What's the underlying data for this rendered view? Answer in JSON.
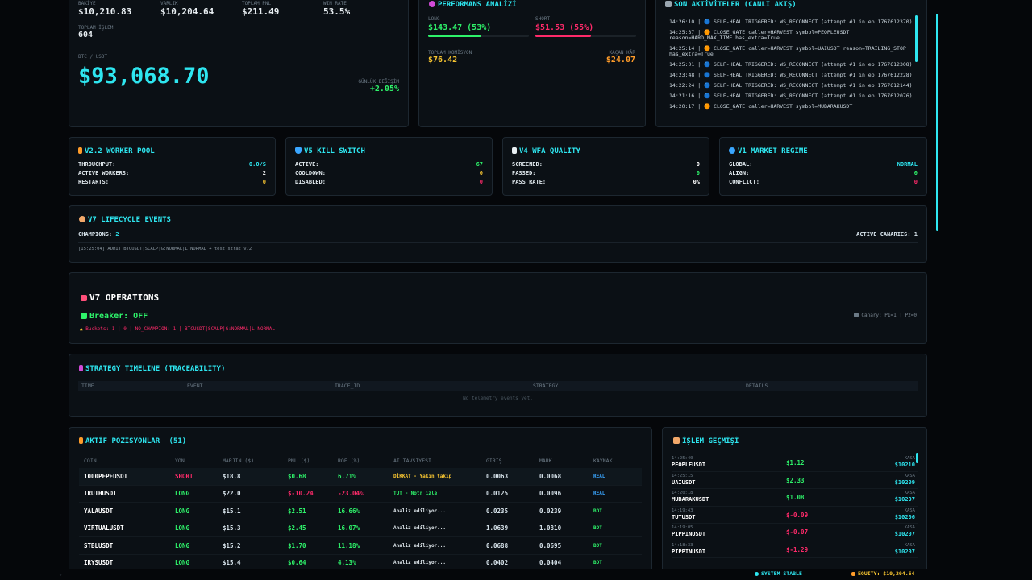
{
  "stats": {
    "balance_label": "BAKİYE",
    "balance": "$10,210.83",
    "equity_label": "VARLIK",
    "equity": "$10,204.64",
    "pnl_label": "TOPLAM PNL",
    "pnl": "$211.49",
    "winrate_label": "WIN RATE",
    "winrate": "53.5%",
    "trades_label": "TOPLAM İŞLEM",
    "trades": "604",
    "pair_label": "BTC / USDT",
    "price": "$93,068.70",
    "change_label": "GÜNLÜK DEĞİŞİM",
    "change": "+2.05%"
  },
  "performance": {
    "title": "PERFORMANS ANALİZİ",
    "long_label": "LONG",
    "long_value": "$143.47 (53%)",
    "long_fill": 0.53,
    "short_label": "SHORT",
    "short_value": "$51.53 (55%)",
    "short_fill": 0.55,
    "commission_label": "TOPLAM KOMİSYON",
    "commission_value": "$76.42",
    "missed_label": "KAÇAN KÂR",
    "missed_value": "$24.07"
  },
  "activity": {
    "title": "SON AKTİVİTELER (CANLI AKIŞ)",
    "lines": [
      "14:26:10 | 🔵 SELF-HEAL TRIGGERED: WS_RECONNECT (attempt #1 in ep:1767612370)",
      "14:25:37 | 🟠 CLOSE_GATE caller=HARVEST symbol=PEOPLEUSDT reason=HARD_MAX_TIME has_extra=True",
      "14:25:14 | 🟠 CLOSE_GATE caller=HARVEST symbol=UAIUSDT reason=TRAILING_STOP has_extra=True",
      "14:25:01 | 🔵 SELF-HEAL TRIGGERED: WS_RECONNECT (attempt #1 in ep:1767612308)",
      "14:23:48 | 🔵 SELF-HEAL TRIGGERED: WS_RECONNECT (attempt #1 in ep:1767612228)",
      "14:22:24 | 🔵 SELF-HEAL TRIGGERED: WS_RECONNECT (attempt #1 in ep:1767612144)",
      "14:21:16 | 🔵 SELF-HEAL TRIGGERED: WS_RECONNECT (attempt #1 in ep:1767612076)",
      "14:20:17 | 🟠 CLOSE_GATE caller=HARVEST symbol=MUBARAKUSDT"
    ]
  },
  "modules": [
    {
      "title": "V2.2 WORKER POOL",
      "icon": "lightning-icon",
      "rows": [
        {
          "label": "THROUGHPUT:",
          "value": "0.0/s",
          "color": "#2ee6f0"
        },
        {
          "label": "ACTIVE WORKERS:",
          "value": "2",
          "color": "#ffffff"
        },
        {
          "label": "RESTARTS:",
          "value": "0",
          "color": "#f7c531"
        }
      ]
    },
    {
      "title": "V5 KILL SWITCH",
      "icon": "shield-icon",
      "rows": [
        {
          "label": "ACTIVE:",
          "value": "67",
          "color": "#2ef26a"
        },
        {
          "label": "COOLDOWN:",
          "value": "0",
          "color": "#f7c531"
        },
        {
          "label": "DISABLED:",
          "value": "0",
          "color": "#ff2a6a"
        }
      ]
    },
    {
      "title": "V4 WFA QUALITY",
      "icon": "check-icon",
      "rows": [
        {
          "label": "SCREENED:",
          "value": "0",
          "color": "#ffffff"
        },
        {
          "label": "PASSED:",
          "value": "0",
          "color": "#2ef26a"
        },
        {
          "label": "PASS RATE:",
          "value": "0%",
          "color": "#ffffff"
        }
      ]
    },
    {
      "title": "V1 MARKET REGIME",
      "icon": "globe-icon",
      "rows": [
        {
          "label": "GLOBAL:",
          "value": "NORMAL",
          "color": "#2ee6f0"
        },
        {
          "label": "ALIGN:",
          "value": "0",
          "color": "#2ef26a"
        },
        {
          "label": "CONFLICT:",
          "value": "0",
          "color": "#ff2a6a"
        }
      ]
    }
  ],
  "lifecycle": {
    "title": "V7 LIFECYCLE EVENTS",
    "champions_label": "CHAMPIONS:",
    "champions": "2",
    "canaries_label": "ACTIVE CANARIES:",
    "canaries": "1",
    "event": "[15:25:04] ADMIT BTCUSDT|SCALP|G:NORMAL|L:NORMAL → test_strat_v72"
  },
  "operations": {
    "title": "V7 OPERATIONS",
    "breaker": "Breaker: OFF",
    "warning": "Buckets: 1 | 0 | NO_CHAMPION: 1 | BTCUSDT|SCALP|G:NORMAL|L:NORMAL",
    "canary": "Canary: P1=1 | P2=0"
  },
  "timeline": {
    "title": "STRATEGY TIMELINE (TRACEABILITY)",
    "columns": [
      "TIME",
      "EVENT",
      "TRACE_ID",
      "STRATEGY",
      "DETAILS"
    ],
    "empty": "No telemetry events yet."
  },
  "positions": {
    "title": "AKTİF POZİSYONLAR",
    "count": "(51)",
    "columns": [
      "COIN",
      "YÖN",
      "MARJİN ($)",
      "PNL ($)",
      "ROE (%)",
      "AI TAVSİYESİ",
      "GİRİŞ",
      "MARK",
      "KAYNAK"
    ],
    "rows": [
      {
        "coin": "1000PEPEUSDT",
        "side": "SHORT",
        "margin": "$18.8",
        "pnl": "$0.68",
        "roe": "6.71%",
        "advice": "DİKKAT - Yakın takip",
        "entry": "0.0063",
        "mark": "0.0068",
        "source": "REAL"
      },
      {
        "coin": "TRUTHUSDT",
        "side": "LONG",
        "margin": "$22.0",
        "pnl": "$-10.24",
        "roe": "-23.04%",
        "advice": "TUT - Notr izle",
        "entry": "0.0125",
        "mark": "0.0096",
        "source": "REAL"
      },
      {
        "coin": "YALAUSDT",
        "side": "LONG",
        "margin": "$15.1",
        "pnl": "$2.51",
        "roe": "16.66%",
        "advice": "Analiz ediliyor...",
        "entry": "0.0235",
        "mark": "0.0239",
        "source": "BOT"
      },
      {
        "coin": "VIRTUALUSDT",
        "side": "LONG",
        "margin": "$15.3",
        "pnl": "$2.45",
        "roe": "16.07%",
        "advice": "Analiz ediliyor...",
        "entry": "1.0639",
        "mark": "1.0810",
        "source": "BOT"
      },
      {
        "coin": "STBLUSDT",
        "side": "LONG",
        "margin": "$15.2",
        "pnl": "$1.70",
        "roe": "11.18%",
        "advice": "Analiz ediliyor...",
        "entry": "0.0688",
        "mark": "0.0695",
        "source": "BOT"
      },
      {
        "coin": "IRYSUSDT",
        "side": "LONG",
        "margin": "$15.4",
        "pnl": "$0.64",
        "roe": "4.13%",
        "advice": "Analiz ediliyor...",
        "entry": "0.0402",
        "mark": "0.0404",
        "source": "BOT"
      }
    ]
  },
  "history": {
    "title": "İŞLEM GEÇMİŞİ",
    "rows": [
      {
        "time": "14:25:40",
        "coin": "PEOPLEUSDT",
        "pnl": "$1.12",
        "status": "KASA",
        "balance": "$10210"
      },
      {
        "time": "14:25:15",
        "coin": "UAIUSDT",
        "pnl": "$2.33",
        "status": "KASA",
        "balance": "$10209"
      },
      {
        "time": "14:20:18",
        "coin": "MUBARAKUSDT",
        "pnl": "$1.08",
        "status": "KASA",
        "balance": "$10207"
      },
      {
        "time": "14:19:43",
        "coin": "TUTUSDT",
        "pnl": "$-0.09",
        "status": "KASA",
        "balance": "$10206"
      },
      {
        "time": "14:19:05",
        "coin": "PIPPINUSDT",
        "pnl": "$-0.07",
        "status": "KASA",
        "balance": "$10207"
      },
      {
        "time": "14:18:33",
        "coin": "PIPPINUSDT",
        "pnl": "$-1.29",
        "status": "KASA",
        "balance": "$10207"
      }
    ]
  },
  "status_bar": {
    "system": "SYSTEM STABLE",
    "equity": "EQUITY: $10,204.64"
  },
  "colors": {
    "accent": "#2ee6f0",
    "green": "#2ef26a",
    "red": "#ff2a6a",
    "yellow": "#f7c531"
  }
}
